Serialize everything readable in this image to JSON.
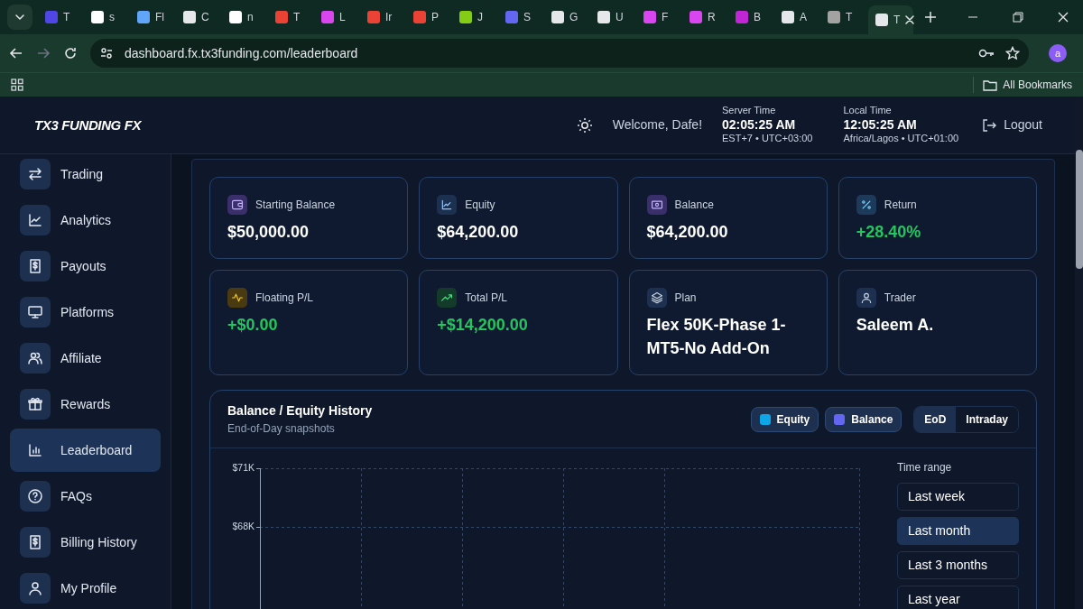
{
  "browser": {
    "tabs": [
      {
        "label": "T",
        "selected": false
      },
      {
        "label": "s",
        "selected": false
      },
      {
        "label": "Fl",
        "selected": false
      },
      {
        "label": "C",
        "selected": false
      },
      {
        "label": "n",
        "selected": false
      },
      {
        "label": "T",
        "selected": false
      },
      {
        "label": "L",
        "selected": false
      },
      {
        "label": "Ir",
        "selected": false
      },
      {
        "label": "P",
        "selected": false
      },
      {
        "label": "J",
        "selected": false
      },
      {
        "label": "S",
        "selected": false
      },
      {
        "label": "G",
        "selected": false
      },
      {
        "label": "U",
        "selected": false
      },
      {
        "label": "F",
        "selected": false
      },
      {
        "label": "R",
        "selected": false
      },
      {
        "label": "B",
        "selected": false
      },
      {
        "label": "A",
        "selected": false
      },
      {
        "label": "T",
        "selected": false
      },
      {
        "label": "T",
        "selected": true
      }
    ],
    "url": "dashboard.fx.tx3funding.com/leaderboard",
    "profile": "a",
    "bookmarks": "All Bookmarks"
  },
  "header": {
    "logo": "TX3 FUNDING FX",
    "welcome": "Welcome, Dafe!",
    "clocks": [
      {
        "label": "Server Time",
        "time": "02:05:25 AM",
        "zone": "EST+7 • UTC+03:00"
      },
      {
        "label": "Local Time",
        "time": "12:05:25 AM",
        "zone": "Africa/Lagos • UTC+01:00"
      }
    ],
    "logout": "Logout"
  },
  "sidebar": {
    "items": [
      {
        "label": "Trading",
        "selected": false
      },
      {
        "label": "Analytics",
        "selected": false
      },
      {
        "label": "Payouts",
        "selected": false
      },
      {
        "label": "Platforms",
        "selected": false
      },
      {
        "label": "Affiliate",
        "selected": false
      },
      {
        "label": "Rewards",
        "selected": false
      },
      {
        "label": "Leaderboard",
        "selected": true
      },
      {
        "label": "FAQs",
        "selected": false
      },
      {
        "label": "Billing History",
        "selected": false
      },
      {
        "label": "My Profile",
        "selected": false
      }
    ]
  },
  "stats": [
    {
      "label": "Starting Balance",
      "value": "$50,000.00",
      "kind": "plain"
    },
    {
      "label": "Equity",
      "value": "$64,200.00",
      "kind": "plain"
    },
    {
      "label": "Balance",
      "value": "$64,200.00",
      "kind": "plain"
    },
    {
      "label": "Return",
      "value": "+28.40%",
      "kind": "gain"
    },
    {
      "label": "Floating P/L",
      "value": "+$0.00",
      "kind": "gain"
    },
    {
      "label": "Total P/L",
      "value": "+$14,200.00",
      "kind": "gain"
    },
    {
      "label": "Plan",
      "value": "Flex 50K-Phase 1-MT5-No Add-On",
      "kind": "plain"
    },
    {
      "label": "Trader",
      "value": "Saleem A.",
      "kind": "plain"
    }
  ],
  "history": {
    "title": "Balance / Equity History",
    "subtitle": "End-of-Day snapshots",
    "legend": [
      {
        "label": "Equity",
        "color": "#0ea5e9"
      },
      {
        "label": "Balance",
        "color": "#6366f1"
      }
    ],
    "modes": [
      {
        "label": "EoD",
        "selected": true
      },
      {
        "label": "Intraday",
        "selected": false
      }
    ],
    "y_axis_labels": [
      "$71K",
      "$68K"
    ],
    "range_label": "Time range",
    "ranges": [
      {
        "label": "Last week",
        "selected": false
      },
      {
        "label": "Last month",
        "selected": true
      },
      {
        "label": "Last 3 months",
        "selected": false
      },
      {
        "label": "Last year",
        "selected": false
      }
    ]
  }
}
